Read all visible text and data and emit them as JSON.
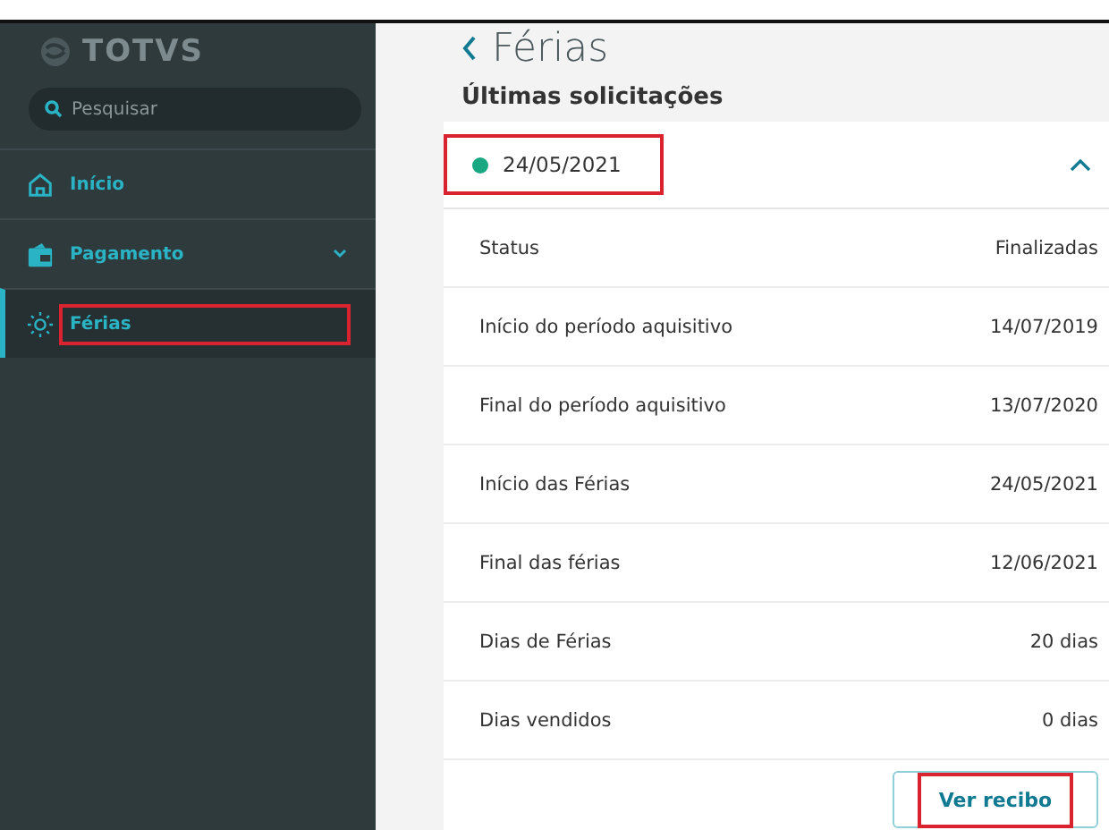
{
  "sidebar": {
    "logo": "TOTVS",
    "search": {
      "placeholder": "Pesquisar"
    },
    "items": [
      {
        "label": "Início",
        "kind": "home",
        "selected": false,
        "expandable": false,
        "highlighted": false
      },
      {
        "label": "Pagamento",
        "kind": "wallet",
        "selected": false,
        "expandable": true,
        "highlighted": false
      },
      {
        "label": "Férias",
        "kind": "sun",
        "selected": true,
        "expandable": false,
        "highlighted": true
      }
    ]
  },
  "page": {
    "title": "Férias",
    "section": "Últimas solicitações",
    "request": {
      "date": "24/05/2021",
      "color": "#1aa882",
      "expanded": true,
      "highlighted": true,
      "rows": [
        {
          "label": "Status",
          "value": "Finalizadas"
        },
        {
          "label": "Início do período aquisitivo",
          "value": "14/07/2019"
        },
        {
          "label": "Final do período aquisitivo",
          "value": "13/07/2020"
        },
        {
          "label": "Início das Férias",
          "value": "24/05/2021"
        },
        {
          "label": "Final das férias",
          "value": "12/06/2021"
        },
        {
          "label": "Dias de Férias",
          "value": "20 dias"
        },
        {
          "label": "Dias vendidos",
          "value": "0 dias"
        }
      ],
      "button": {
        "label": "Ver recibo",
        "highlighted": true
      }
    }
  }
}
